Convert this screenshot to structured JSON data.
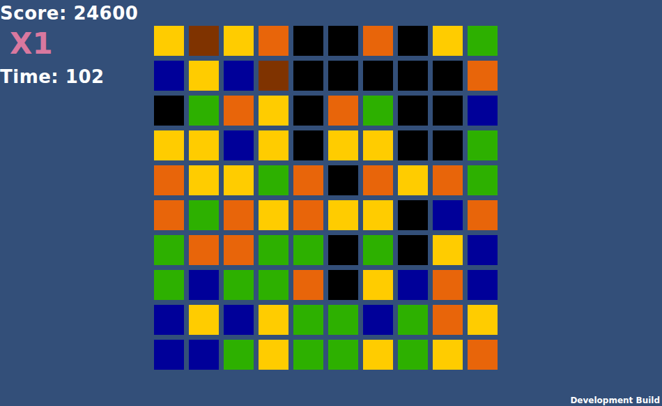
{
  "hud": {
    "score": "Score: 24600",
    "multiplier": "X1",
    "time": "Time: 102"
  },
  "board": {
    "rows": [
      [
        {
          "color": "#ffcc00"
        },
        {
          "color": "#7f3300"
        },
        {
          "color": "#ffcc00"
        },
        {
          "color": "#e8650a"
        },
        {
          "color": "#000000"
        },
        {
          "color": "#000000"
        },
        {
          "color": "#e8650a"
        },
        {
          "color": "#000000"
        },
        {
          "color": "#ffcc00"
        },
        {
          "color": "#2db000"
        }
      ],
      [
        {
          "color": "#000099"
        },
        {
          "color": "#ffcc00"
        },
        {
          "color": "#000099"
        },
        {
          "color": "#7f3300"
        },
        {
          "color": "#000000"
        },
        {
          "color": "#000000"
        },
        {
          "color": "#000000"
        },
        {
          "color": "#000000"
        },
        {
          "color": "#000000"
        },
        {
          "color": "#e8650a"
        }
      ],
      [
        {
          "color": "#000000"
        },
        {
          "color": "#2db000"
        },
        {
          "color": "#e8650a"
        },
        {
          "color": "#ffcc00"
        },
        {
          "color": "#000000"
        },
        {
          "color": "#e8650a"
        },
        {
          "color": "#2db000"
        },
        {
          "color": "#000000"
        },
        {
          "color": "#000000"
        },
        {
          "color": "#000099"
        }
      ],
      [
        {
          "color": "#ffcc00"
        },
        {
          "color": "#ffcc00"
        },
        {
          "color": "#000099"
        },
        {
          "color": "#ffcc00"
        },
        {
          "color": "#000000"
        },
        {
          "color": "#ffcc00"
        },
        {
          "color": "#ffcc00"
        },
        {
          "color": "#000000"
        },
        {
          "color": "#000000"
        },
        {
          "color": "#2db000"
        }
      ],
      [
        {
          "color": "#e8650a"
        },
        {
          "color": "#ffcc00"
        },
        {
          "color": "#ffcc00"
        },
        {
          "color": "#2db000"
        },
        {
          "color": "#e8650a"
        },
        {
          "color": "#000000"
        },
        {
          "color": "#e8650a"
        },
        {
          "color": "#ffcc00"
        },
        {
          "color": "#e8650a"
        },
        {
          "color": "#2db000"
        }
      ],
      [
        {
          "color": "#e8650a"
        },
        {
          "color": "#2db000"
        },
        {
          "color": "#e8650a"
        },
        {
          "color": "#ffcc00"
        },
        {
          "color": "#e8650a"
        },
        {
          "color": "#ffcc00"
        },
        {
          "color": "#ffcc00"
        },
        {
          "color": "#000000"
        },
        {
          "color": "#000099"
        },
        {
          "color": "#e8650a"
        }
      ],
      [
        {
          "color": "#2db000"
        },
        {
          "color": "#e8650a"
        },
        {
          "color": "#e8650a"
        },
        {
          "color": "#2db000"
        },
        {
          "color": "#2db000"
        },
        {
          "color": "#000000"
        },
        {
          "color": "#2db000"
        },
        {
          "color": "#000000"
        },
        {
          "color": "#ffcc00"
        },
        {
          "color": "#000099"
        }
      ],
      [
        {
          "color": "#2db000"
        },
        {
          "color": "#000099"
        },
        {
          "color": "#2db000"
        },
        {
          "color": "#2db000"
        },
        {
          "color": "#e8650a"
        },
        {
          "color": "#000000"
        },
        {
          "color": "#ffcc00"
        },
        {
          "color": "#000099"
        },
        {
          "color": "#e8650a"
        },
        {
          "color": "#000099"
        }
      ],
      [
        {
          "color": "#000099"
        },
        {
          "color": "#ffcc00"
        },
        {
          "color": "#000099"
        },
        {
          "color": "#ffcc00"
        },
        {
          "color": "#2db000"
        },
        {
          "color": "#2db000"
        },
        {
          "color": "#000099"
        },
        {
          "color": "#2db000"
        },
        {
          "color": "#e8650a"
        },
        {
          "color": "#ffcc00"
        }
      ],
      [
        {
          "color": "#000099"
        },
        {
          "color": "#000099"
        },
        {
          "color": "#2db000"
        },
        {
          "color": "#ffcc00"
        },
        {
          "color": "#2db000"
        },
        {
          "color": "#2db000"
        },
        {
          "color": "#ffcc00"
        },
        {
          "color": "#2db000"
        },
        {
          "color": "#ffcc00"
        },
        {
          "color": "#e8650a"
        }
      ]
    ]
  },
  "footer": "Development Build"
}
